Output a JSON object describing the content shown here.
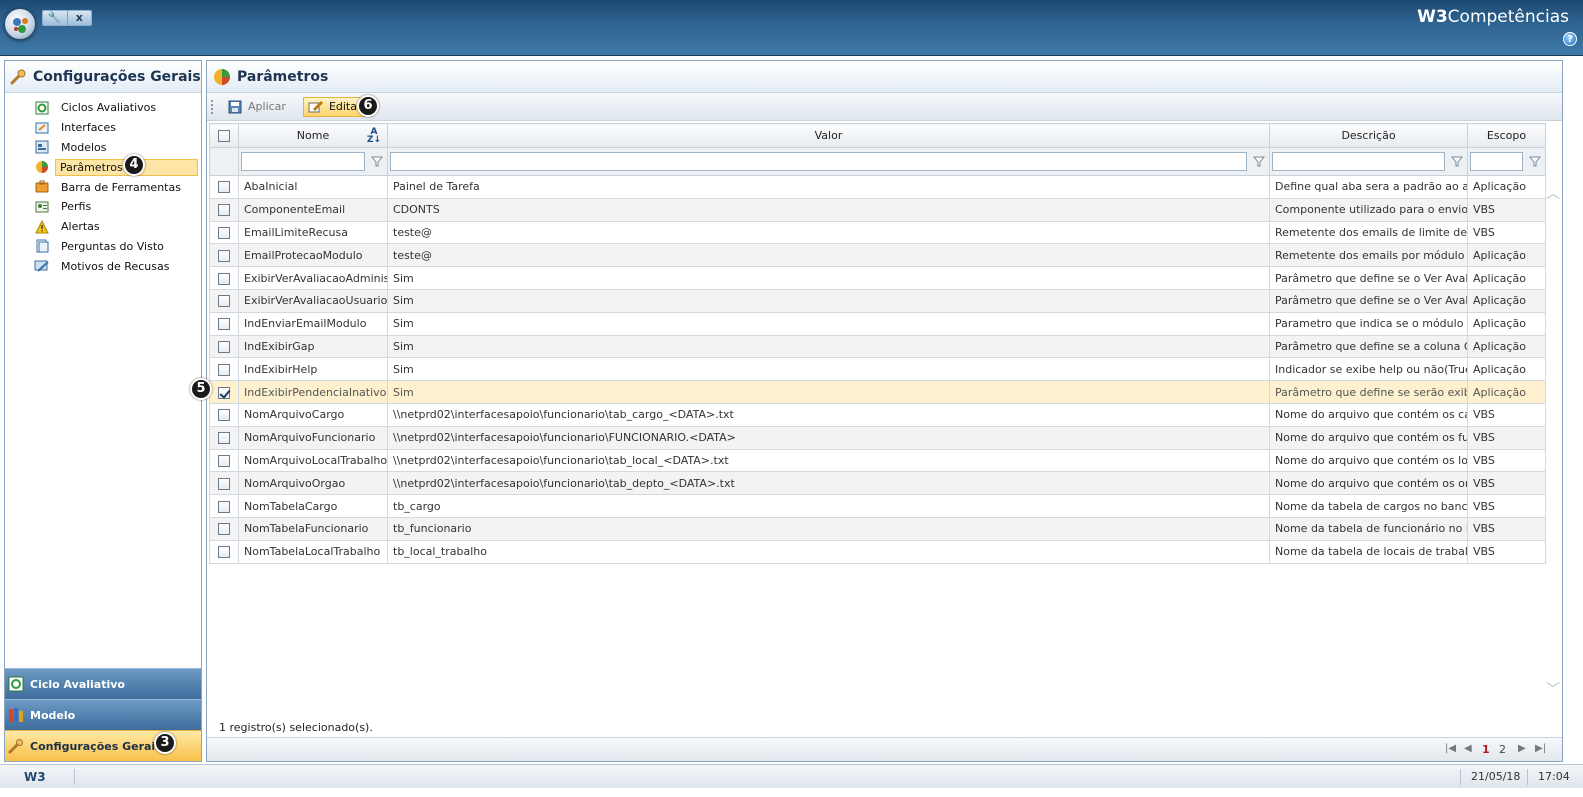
{
  "app": {
    "brand_bold": "W3",
    "brand_rest": "Competências",
    "quick_access": [
      "🔧",
      "x"
    ],
    "help_label": "?"
  },
  "left_panel": {
    "title": "Configurações Gerais",
    "tree": [
      {
        "label": "Ciclos Avaliativos",
        "icon": "cycle-icon"
      },
      {
        "label": "Interfaces",
        "icon": "interfaces-icon"
      },
      {
        "label": "Modelos",
        "icon": "models-icon"
      },
      {
        "label": "Parâmetros",
        "icon": "parameters-icon",
        "selected": true
      },
      {
        "label": "Barra de Ferramentas",
        "icon": "toolbar-icon"
      },
      {
        "label": "Perfis",
        "icon": "profiles-icon"
      },
      {
        "label": "Alertas",
        "icon": "warning-icon"
      },
      {
        "label": "Perguntas do Visto",
        "icon": "questions-icon"
      },
      {
        "label": "Motivos de Recusas",
        "icon": "refusal-icon"
      }
    ],
    "accordion": [
      {
        "label": "Ciclo Avaliativo",
        "icon": "cycle-icon"
      },
      {
        "label": "Modelo",
        "icon": "model-icon"
      },
      {
        "label": "Configurações Gerais",
        "icon": "wrench-icon",
        "active": true
      }
    ]
  },
  "main": {
    "title": "Parâmetros",
    "toolbar": {
      "apply_label": "Aplicar",
      "edit_label": "Editar"
    },
    "columns": {
      "name": "Nome",
      "value": "Valor",
      "description": "Descrição",
      "scope": "Escopo"
    },
    "rows": [
      {
        "name": "AbaInicial",
        "value": "Painel de Tarefa",
        "description": "Define qual aba sera a padrão ao abrir o",
        "scope": "Aplicação",
        "checked": false
      },
      {
        "name": "ComponenteEmail",
        "value": "CDONTS",
        "description": "Componente utilizado para o envio de em",
        "scope": "VBS",
        "checked": false
      },
      {
        "name": "EmailLimiteRecusa",
        "value": "teste@",
        "description": "Remetente dos emails de limite de recusa",
        "scope": "VBS",
        "checked": false
      },
      {
        "name": "EmailProtecaoModulo",
        "value": "teste@",
        "description": "Remetente dos emails por módulo",
        "scope": "Aplicação",
        "checked": false
      },
      {
        "name": "ExibirVerAvaliacaoAdministrad",
        "value": "Sim",
        "description": "Parâmetro que define se o Ver Avaliação",
        "scope": "Aplicação",
        "checked": false
      },
      {
        "name": "ExibirVerAvaliacaoUsuario",
        "value": "Sim",
        "description": "Parâmetro que define se o Ver Avaliação",
        "scope": "Aplicação",
        "checked": false
      },
      {
        "name": "IndEnviarEmailModulo",
        "value": "Sim",
        "description": "Parametro que indica se o módulo podera",
        "scope": "Aplicação",
        "checked": false
      },
      {
        "name": "IndExibirGap",
        "value": "Sim",
        "description": "Parâmetro que define se a coluna GAP se",
        "scope": "Aplicação",
        "checked": false
      },
      {
        "name": "IndExibirHelp",
        "value": "Sim",
        "description": "Indicador se exibe help ou não(True ou F",
        "scope": "Aplicação",
        "checked": false
      },
      {
        "name": "IndExibirPendenciaInativos",
        "value": "Sim",
        "description": "Parâmetro que define se serão exibidas a",
        "scope": "Aplicação",
        "checked": true
      },
      {
        "name": "NomArquivoCargo",
        "value": "\\\\netprd02\\interfacesapoio\\funcionario\\tab_cargo_<DATA>.txt",
        "description": "Nome do arquivo que contém os cargos",
        "scope": "VBS",
        "checked": false
      },
      {
        "name": "NomArquivoFuncionario",
        "value": "\\\\netprd02\\interfacesapoio\\funcionario\\FUNCIONARIO.<DATA>",
        "description": "Nome do arquivo que contém os funciona",
        "scope": "VBS",
        "checked": false
      },
      {
        "name": "NomArquivoLocalTrabalho",
        "value": "\\\\netprd02\\interfacesapoio\\funcionario\\tab_local_<DATA>.txt",
        "description": "Nome do arquivo que contém os locais de",
        "scope": "VBS",
        "checked": false
      },
      {
        "name": "NomArquivoOrgao",
        "value": "\\\\netprd02\\interfacesapoio\\funcionario\\tab_depto_<DATA>.txt",
        "description": "Nome do arquivo que contém os orgãos",
        "scope": "VBS",
        "checked": false
      },
      {
        "name": "NomTabelaCargo",
        "value": "tb_cargo",
        "description": "Nome da tabela de cargos no banco de d",
        "scope": "VBS",
        "checked": false
      },
      {
        "name": "NomTabelaFuncionario",
        "value": "tb_funcionario",
        "description": "Nome da tabela de funcionário no banco",
        "scope": "VBS",
        "checked": false
      },
      {
        "name": "NomTabelaLocalTrabalho",
        "value": "tb_local_trabalho",
        "description": "Nome da tabela de locais de trabalho no",
        "scope": "VBS",
        "checked": false
      }
    ],
    "selection_status": "1 registro(s) selecionado(s).",
    "pager": {
      "pages": [
        "1",
        "2"
      ],
      "current": "1"
    }
  },
  "callouts": [
    "3",
    "4",
    "5",
    "6"
  ],
  "statusbar": {
    "logo": "W3",
    "date": "21/05/18",
    "time": "17:04"
  },
  "colors": {
    "selected_bg": "#fde5a6",
    "header_blue": "#2f6593",
    "accordion_blue": "#3e6d9c",
    "accent_orange": "#f8c04a"
  }
}
